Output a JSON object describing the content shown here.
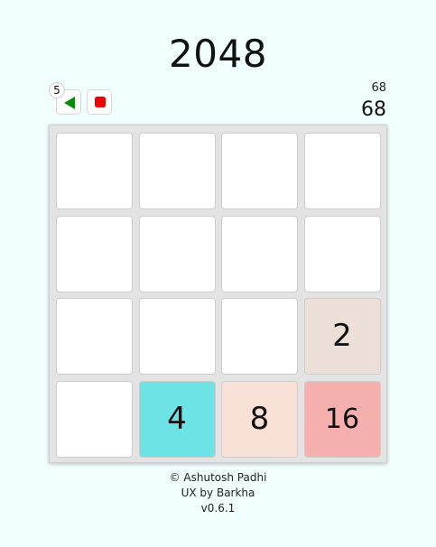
{
  "header": {
    "title": "2048"
  },
  "controls": {
    "undo_count": "5",
    "undo_icon": "undo-arrow-icon",
    "stop_icon": "stop-icon",
    "undo_color": "#0a8a0a",
    "stop_color": "#ee0000"
  },
  "score": {
    "best": "68",
    "current": "68"
  },
  "board": {
    "cells": [
      [
        "",
        "",
        "",
        ""
      ],
      [
        "",
        "",
        "",
        ""
      ],
      [
        "",
        "",
        "",
        "2"
      ],
      [
        "",
        "4",
        "8",
        "16"
      ]
    ],
    "tile_colors": {
      "empty": "#ffffff",
      "2": "#ecdfd8",
      "4": "#6ee3e6",
      "8": "#f9e0d6",
      "16": "#f5b0ae"
    }
  },
  "footer": {
    "copyright": "© Ashutosh Padhi",
    "ux": "UX by Barkha",
    "version": "v0.6.1"
  }
}
